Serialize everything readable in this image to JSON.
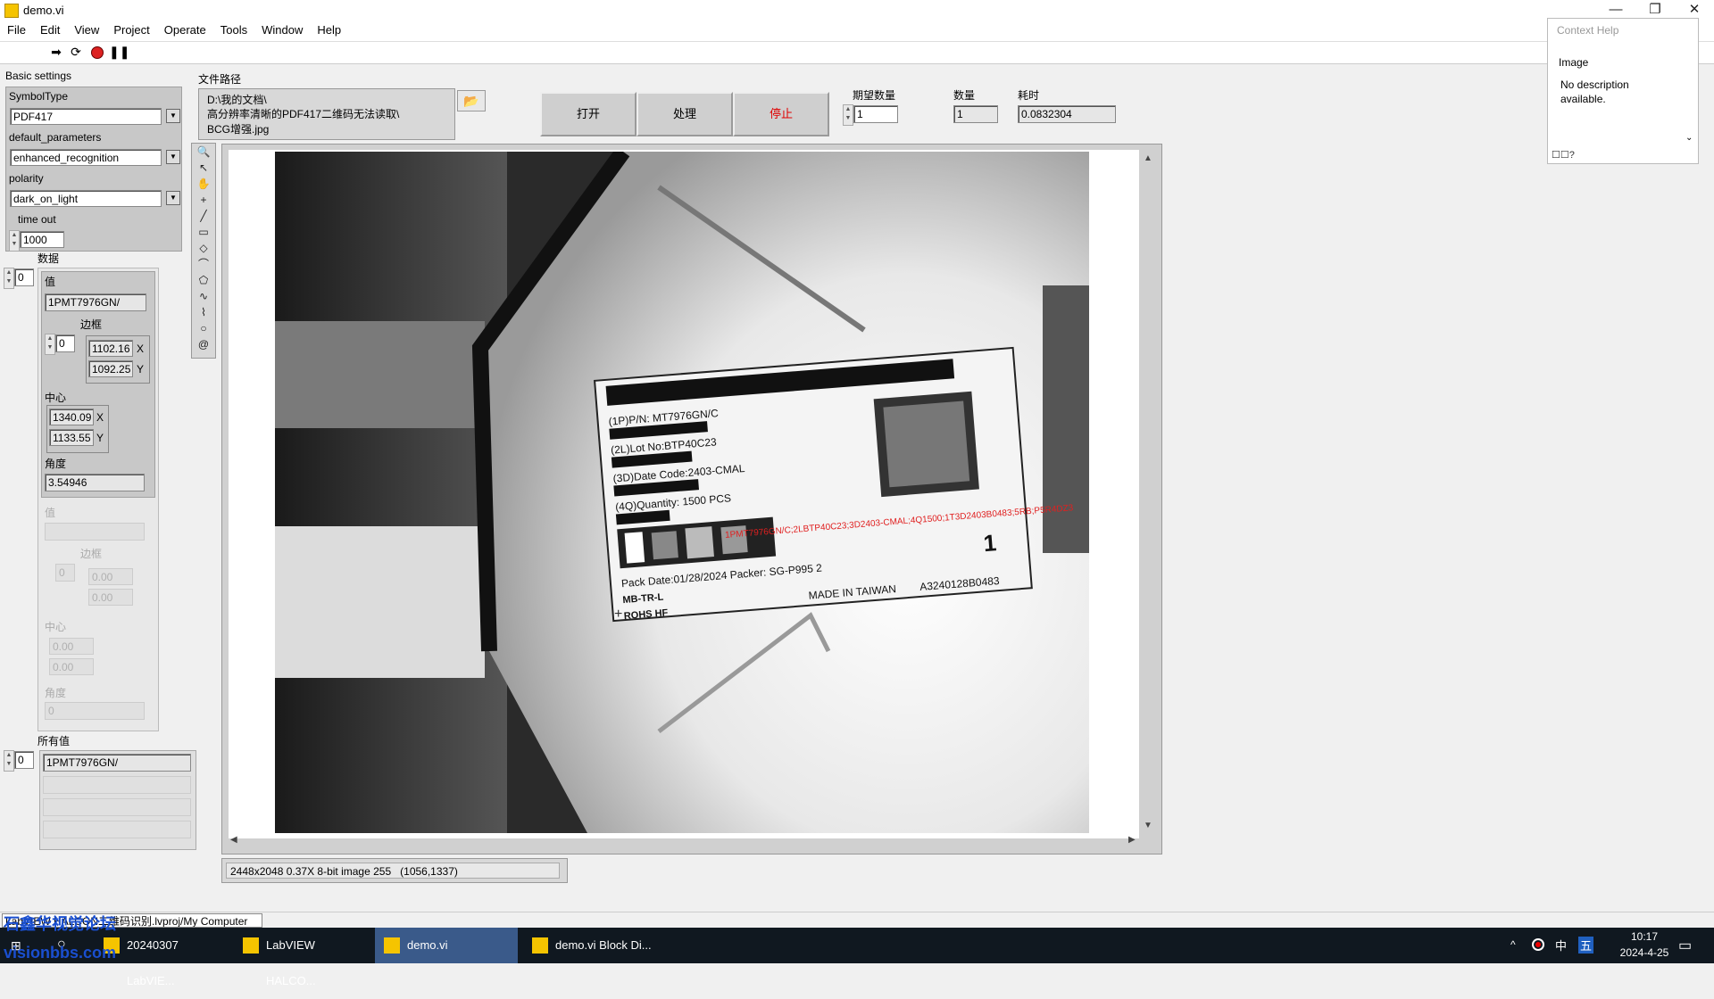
{
  "window": {
    "title": "demo.vi",
    "min": "—",
    "restore": "❐",
    "close": "✕"
  },
  "menu": [
    "File",
    "Edit",
    "View",
    "Project",
    "Operate",
    "Tools",
    "Window",
    "Help"
  ],
  "section_title": "Basic  settings",
  "symbol_type": {
    "label": "SymbolType",
    "value": "PDF417"
  },
  "default_parameters": {
    "label": "default_parameters",
    "value": "enhanced_recognition"
  },
  "polarity": {
    "label": "polarity",
    "value": "dark_on_light"
  },
  "timeout": {
    "label": "time out",
    "value": "1000"
  },
  "data_cluster": {
    "label": "数据",
    "index": "0",
    "value_label": "值",
    "value": "1PMT7976GN/",
    "border_label": "边框",
    "border_index": "0",
    "border_x": "1102.16",
    "border_y": "1092.25",
    "x": "X",
    "y": "Y",
    "center_label": "中心",
    "center_x": "1340.09",
    "center_y": "1133.55",
    "angle_label": "角度",
    "angle": "3.54946",
    "dis_value_label": "值",
    "dis_border_label": "边框",
    "dis_index": "0",
    "dis_bx": "0.00",
    "dis_by": "0.00",
    "dis_center_label": "中心",
    "dis_cx": "0.00",
    "dis_cy": "0.00",
    "dis_angle_label": "角度",
    "dis_angle": "0"
  },
  "all_values": {
    "label": "所有值",
    "index": "0",
    "value": "1PMT7976GN/"
  },
  "file_path": {
    "label": "文件路径",
    "line1": "D:\\我的文档\\",
    "line2": "高分辨率清晰的PDF417二维码无法读取\\",
    "line3": "BCG增强.jpg"
  },
  "buttons": {
    "open": "打开",
    "process": "处理",
    "stop": "停止"
  },
  "expected_count": {
    "label": "期望数量",
    "value": "1"
  },
  "count": {
    "label": "数量",
    "value": "1"
  },
  "time_cost": {
    "label": "耗时",
    "value": "0.0832304"
  },
  "image_status": {
    "info": "2448x2048 0.37X 8-bit image 255",
    "coords": "(1056,1337)"
  },
  "label_text": {
    "pn": "(1P)P/N:  MT7976GN/C",
    "lot": "(2L)Lot No:BTP40C23",
    "date": "(3D)Date Code:2403-CMAL",
    "qty": "(4Q)Quantity: 1500 PCS",
    "pack": "Pack Date:01/28/2024    Packer: SG-P995  2",
    "mbtr": "MB-TR-L",
    "made": "MADE IN TAIWAN",
    "rohs": "ROHS HF",
    "code": "A3240128B0483",
    "one": "1",
    "overlay": "1PMT7976GN/C;2LBTP40C23;3D2403-CMAL;4Q1500;1T3D2403B0483;5RB;P5R4DZ3"
  },
  "context_help": {
    "title": "Context Help",
    "heading": "Image",
    "body": "No description available."
  },
  "project_tab": "LabVIEW HALCON二维码识别.lvproj/My Computer",
  "taskbar": {
    "items": [
      "20240307 LabVIE...",
      "LabVIEW HALCO...",
      "demo.vi",
      "demo.vi Block Di..."
    ],
    "time": "10:17",
    "date": "2024-4-25",
    "ime1": "中",
    "ime2": "五",
    "watermark1": "石鑫华视觉论坛",
    "watermark2": "visionbbs.com"
  },
  "colors": {
    "stop_text": "#e00000",
    "overlay_red": "#e02020",
    "taskbar": "#101820",
    "active_task": "#3a5a8a"
  }
}
